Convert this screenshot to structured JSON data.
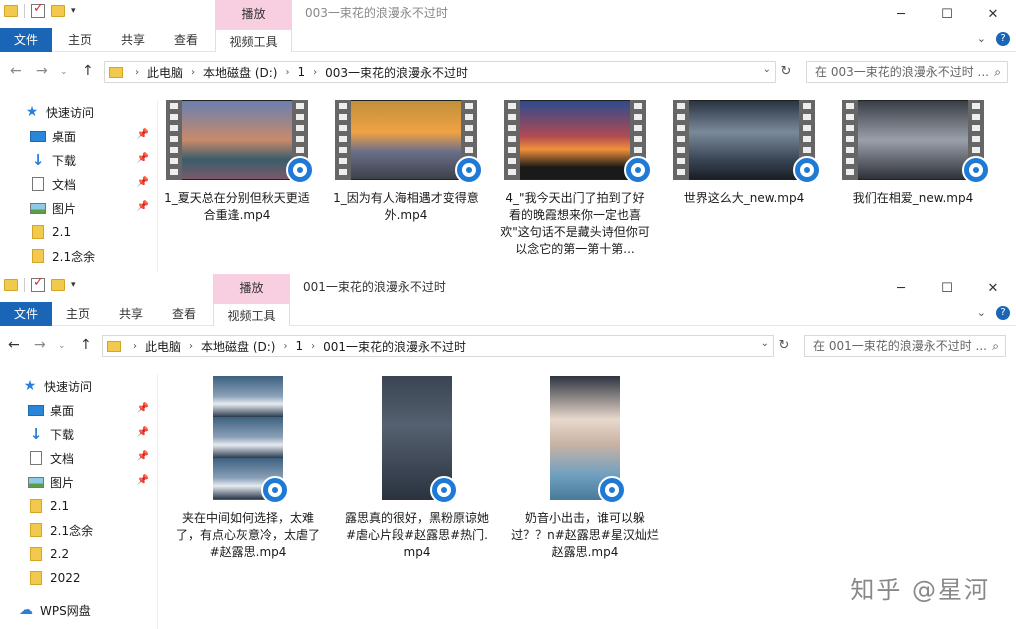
{
  "window1": {
    "title": "003一束花的浪漫永不过时",
    "context_tab": "播放",
    "ribbon_tabs": [
      "文件",
      "主页",
      "共享",
      "查看",
      "视频工具"
    ],
    "breadcrumb": [
      "此电脑",
      "本地磁盘 (D:)",
      "1",
      "003一束花的浪漫永不过时"
    ],
    "search_placeholder": "在 003一束花的浪漫永不过时 ...",
    "sidebar": [
      {
        "label": "快速访问",
        "icon": "star-icon"
      },
      {
        "label": "桌面",
        "icon": "desktop-icon",
        "pinned": true
      },
      {
        "label": "下载",
        "icon": "download-icon",
        "pinned": true
      },
      {
        "label": "文档",
        "icon": "document-icon",
        "pinned": true
      },
      {
        "label": "图片",
        "icon": "pictures-icon",
        "pinned": true
      },
      {
        "label": "2.1",
        "icon": "folder-icon"
      },
      {
        "label": "2.1念余",
        "icon": "folder-icon"
      }
    ],
    "files": [
      "1_夏天总在分别但秋天更适合重逢.mp4",
      "1_因为有人海相遇才变得意外.mp4",
      "4_\"我今天出门了拍到了好看的晚霞想来你一定也喜欢\"这句话不是藏头诗但你可以念它的第一第十第...",
      "世界这么大_new.mp4",
      "我们在相爱_new.mp4"
    ]
  },
  "window2": {
    "title": "001一束花的浪漫永不过时",
    "context_tab": "播放",
    "ribbon_tabs": [
      "文件",
      "主页",
      "共享",
      "查看",
      "视频工具"
    ],
    "breadcrumb": [
      "此电脑",
      "本地磁盘 (D:)",
      "1",
      "001一束花的浪漫永不过时"
    ],
    "search_placeholder": "在 001一束花的浪漫永不过时 ...",
    "sidebar": [
      {
        "label": "快速访问",
        "icon": "star-icon"
      },
      {
        "label": "桌面",
        "icon": "desktop-icon",
        "pinned": true
      },
      {
        "label": "下载",
        "icon": "download-icon",
        "pinned": true
      },
      {
        "label": "文档",
        "icon": "document-icon",
        "pinned": true
      },
      {
        "label": "图片",
        "icon": "pictures-icon",
        "pinned": true
      },
      {
        "label": "2.1",
        "icon": "folder-icon"
      },
      {
        "label": "2.1念余",
        "icon": "folder-icon"
      },
      {
        "label": "2.2",
        "icon": "folder-icon"
      },
      {
        "label": "2022",
        "icon": "folder-icon"
      },
      {
        "label": "WPS网盘",
        "icon": "cloud-icon"
      }
    ],
    "files": [
      "夹在中间如何选择，太难了，有点心灰意冷，太虐了#赵露思.mp4",
      "露思真的很好，黑粉原谅她#虐心片段#赵露思#热门.mp4",
      "奶音小出击，谁可以躲过？？n#赵露思#星汉灿烂赵露思.mp4"
    ]
  },
  "watermark": "知乎 @星河",
  "colors": {
    "accent": "#1a65b5",
    "context_tab": "#f8cfe0",
    "folder": "#f2c94c",
    "player_badge": "#1f7ad6"
  }
}
